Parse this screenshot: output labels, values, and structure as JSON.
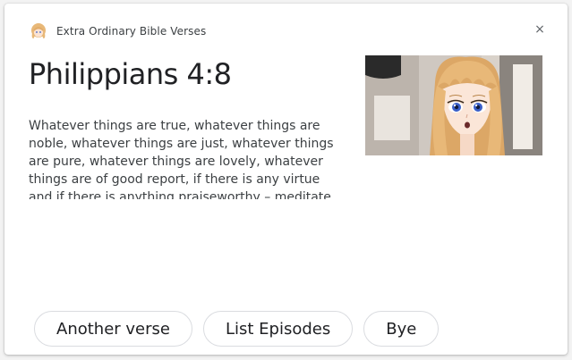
{
  "header": {
    "app_name": "Extra Ordinary Bible Verses",
    "avatar_icon": "anime-girl-avatar-icon"
  },
  "close_icon": "×",
  "card": {
    "title": "Philippians 4:8",
    "verse": "Whatever things are true, whatever things are noble, whatever things are just, whatever things are pure, whatever things are lovely, whatever things are of good report, if there is any virtue and if there is anything praiseworthy – meditate on these things.",
    "image_icon": "anime-girl-portrait-icon"
  },
  "suggestions": [
    {
      "label": "Another verse"
    },
    {
      "label": "List Episodes"
    },
    {
      "label": "Bye"
    }
  ],
  "colors": {
    "background": "#f3f3f3",
    "card": "#ffffff",
    "hair": "#e8b878",
    "eyes": "#3a5fc8",
    "chip_border": "#dadce0"
  }
}
